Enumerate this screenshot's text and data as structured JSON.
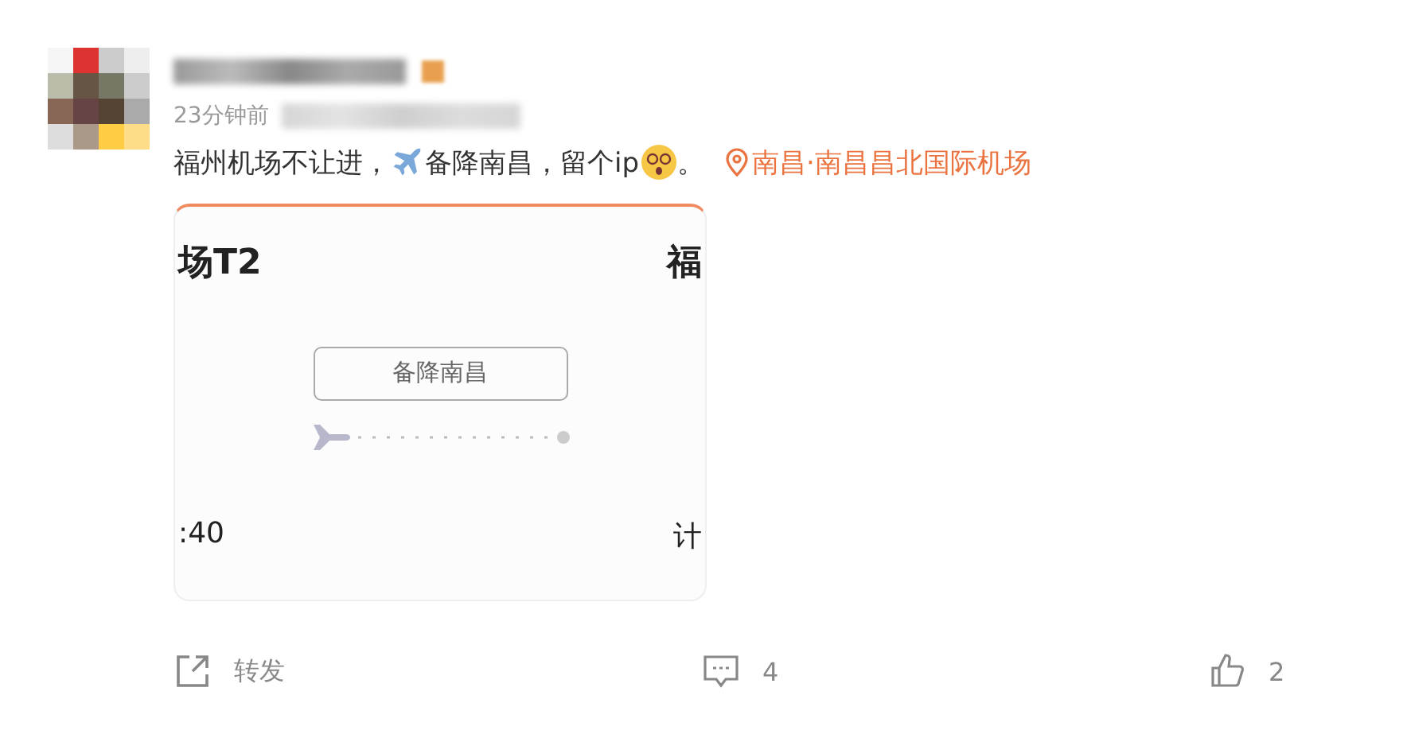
{
  "post": {
    "time": "23分钟前",
    "text": [
      {
        "kind": "text",
        "value": "福州机场不让进，"
      },
      {
        "kind": "plane"
      },
      {
        "kind": "text",
        "value": "备降南昌，留个ip"
      },
      {
        "kind": "dizzy"
      },
      {
        "kind": "text",
        "value": "。"
      }
    ],
    "location": "南昌·南昌昌北国际机场"
  },
  "card": {
    "origin": "场T2",
    "destination": "福",
    "status": "备降南昌",
    "depart_time": ":40",
    "arrive_label": "计"
  },
  "actions": [
    {
      "kind": "repost",
      "label": "转发"
    },
    {
      "kind": "comment",
      "label": "4"
    },
    {
      "kind": "like",
      "label": "2"
    }
  ]
}
